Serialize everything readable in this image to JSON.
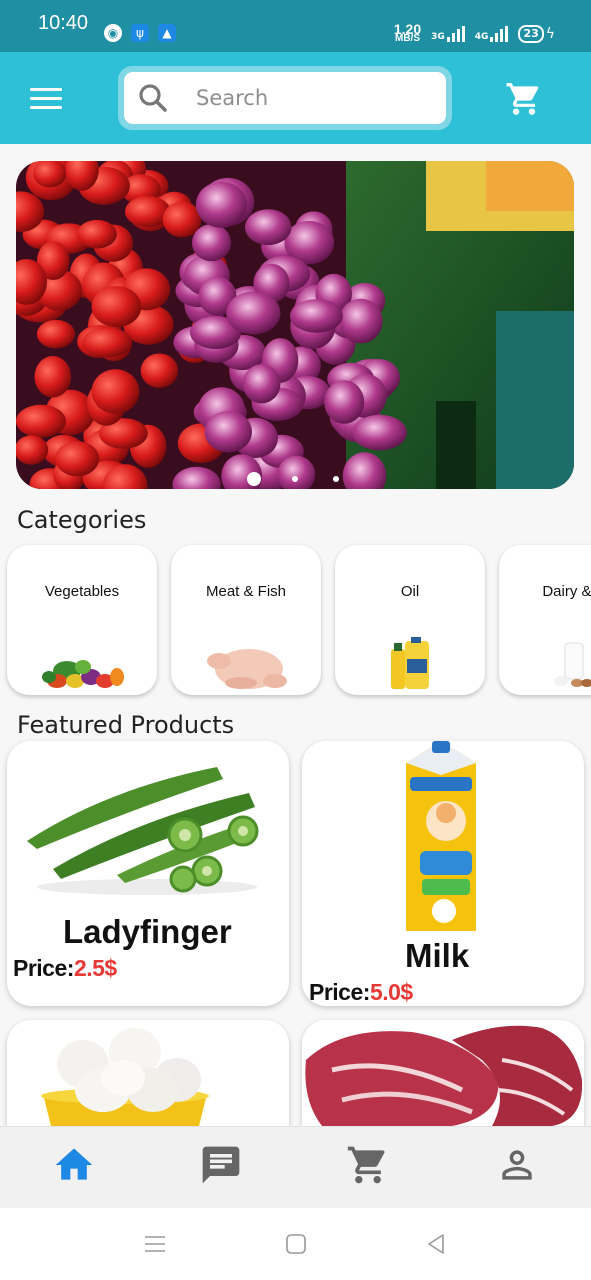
{
  "status_bar": {
    "time": "10:40",
    "net_speed_value": "1.20",
    "net_speed_unit": "MB/S",
    "signal1_label": "3G",
    "signal2_label": "4G",
    "battery": "23"
  },
  "app_bar": {
    "search_placeholder": "Search",
    "icons": [
      "menu-icon",
      "search-icon",
      "cart-icon"
    ]
  },
  "banner": {
    "image": "fresh-vegetables-photo",
    "slides_count": 3,
    "active_slide": 1
  },
  "categories": {
    "title": "Categories",
    "items": [
      {
        "label": "Vegetables",
        "icon": "vegetables-image"
      },
      {
        "label": "Meat & Fish",
        "icon": "chicken-image"
      },
      {
        "label": "Oil",
        "icon": "oil-bottles-image"
      },
      {
        "label": "Dairy & E",
        "icon": "dairy-image"
      }
    ]
  },
  "featured": {
    "title": "Featured Products",
    "price_label": "Price:",
    "products": [
      {
        "name": "Ladyfinger",
        "price": "2.5$",
        "image": "okra-image"
      },
      {
        "name": "Milk",
        "price": "5.0$",
        "image": "milk-carton-image"
      },
      {
        "name": "",
        "price": "",
        "image": "eggs-image"
      },
      {
        "name": "",
        "price": "",
        "image": "meat-image"
      }
    ]
  },
  "bottom_nav": {
    "items": [
      "home-icon",
      "messages-icon",
      "cart-icon",
      "profile-icon"
    ],
    "active": "home-icon",
    "active_color": "#1e88e5",
    "inactive_color": "#666666"
  },
  "colors": {
    "status_bar": "#1f8fa3",
    "app_bar": "#2ec0d6",
    "price_accent": "#e53935"
  }
}
